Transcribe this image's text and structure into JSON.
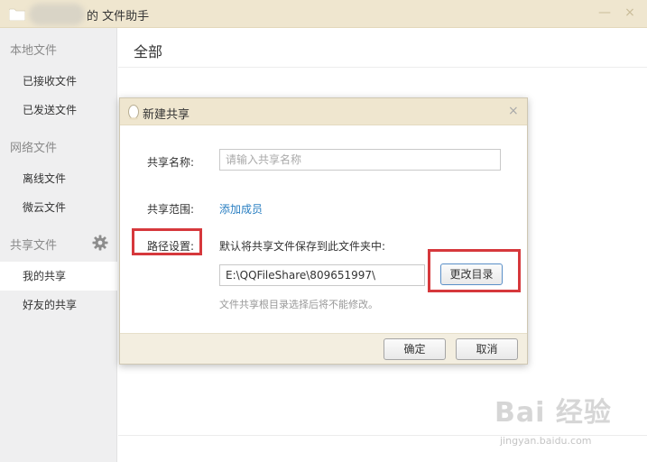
{
  "window": {
    "title_suffix": "的 文件助手",
    "min_glyph": "—",
    "close_glyph": "×"
  },
  "sidebar": {
    "local_section": "本地文件",
    "received": "已接收文件",
    "sent": "已发送文件",
    "network_section": "网络文件",
    "offline": "离线文件",
    "weiyun": "微云文件",
    "share_section": "共享文件",
    "my_share": "我的共享",
    "friend_share": "好友的共享"
  },
  "main": {
    "title": "全部"
  },
  "dialog": {
    "title": "新建共享",
    "close_glyph": "×",
    "share_name_label": "共享名称:",
    "share_name_value": "",
    "share_name_placeholder": "请输入共享名称",
    "scope_label": "共享范围:",
    "add_member_link": "添加成员",
    "path_label": "路径设置:",
    "path_desc": "默认将共享文件保存到此文件夹中:",
    "path_value": "E:\\QQFileShare\\809651997\\",
    "change_dir_button": "更改目录",
    "path_hint": "文件共享根目录选择后将不能修改。",
    "ok_button": "确定",
    "cancel_button": "取消"
  },
  "watermark": {
    "brand": "Bai 经验",
    "url": "jingyan.baidu.com"
  },
  "colors": {
    "titlebar": "#efe6cf",
    "sidebar": "#efeff0",
    "link": "#2a7fc2",
    "highlight": "#d6383c"
  }
}
